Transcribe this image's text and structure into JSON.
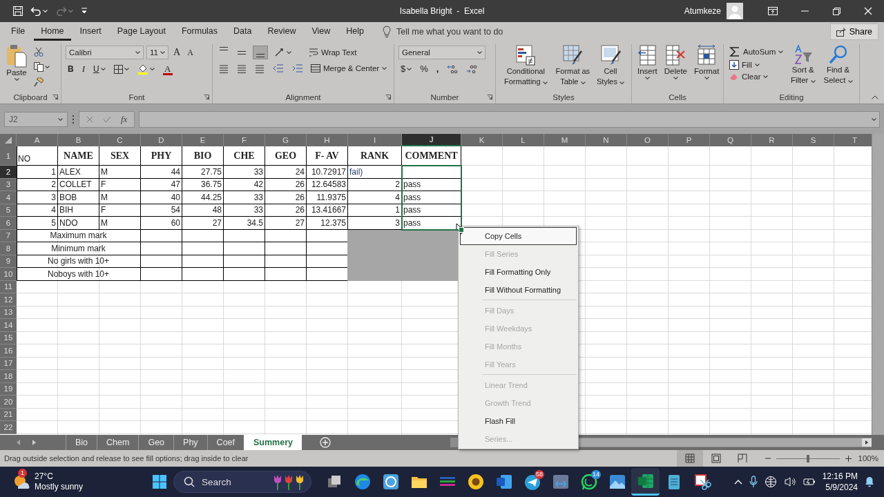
{
  "title_bar": {
    "title": "Isabella Bright  -  Excel",
    "user": "Atumkeze"
  },
  "menu_tabs": [
    {
      "label": "File",
      "selected": false
    },
    {
      "label": "Home",
      "selected": true
    },
    {
      "label": "Insert",
      "selected": false
    },
    {
      "label": "Page Layout",
      "selected": false
    },
    {
      "label": "Formulas",
      "selected": false
    },
    {
      "label": "Data",
      "selected": false
    },
    {
      "label": "Review",
      "selected": false
    },
    {
      "label": "View",
      "selected": false
    },
    {
      "label": "Help",
      "selected": false
    }
  ],
  "tell_me": {
    "placeholder": "Tell me what you want to do"
  },
  "share_button": "Share",
  "ribbon": {
    "clipboard": {
      "paste": "Paste",
      "label": "Clipboard"
    },
    "font": {
      "font_name": "Calibri",
      "font_size": "11",
      "grow": "A",
      "shrink": "A",
      "bold": "B",
      "italic": "I",
      "underline": "U",
      "font_color": "A",
      "label": "Font"
    },
    "alignment": {
      "valign": [
        {
          "selected": false
        },
        {
          "selected": false
        },
        {
          "selected": true
        }
      ],
      "wrap_text": "Wrap Text",
      "merge_center": "Merge & Center",
      "label": "Alignment"
    },
    "number": {
      "format": "General",
      "currency": "$",
      "percent": "%",
      "comma": ",",
      "label": "Number"
    },
    "styles": {
      "buttons": [
        "Conditional Formatting",
        "Format as Table",
        "Cell Styles"
      ],
      "label": "Styles"
    },
    "cells": {
      "buttons": [
        "Insert",
        "Delete",
        "Format"
      ],
      "label": "Cells"
    },
    "editing": {
      "autosum": "AutoSum",
      "fill": "Fill",
      "clear": "Clear",
      "sort_filter": "Sort & Filter",
      "find_select": "Find & Select",
      "label": "Editing"
    }
  },
  "formula_bar": {
    "name_box": "J2",
    "fx": "fx"
  },
  "sheet": {
    "columns": [
      {
        "label": "A",
        "selected": false
      },
      {
        "label": "B",
        "selected": false
      },
      {
        "label": "C",
        "selected": false
      },
      {
        "label": "D",
        "selected": false
      },
      {
        "label": "E",
        "selected": false
      },
      {
        "label": "F",
        "selected": false
      },
      {
        "label": "G",
        "selected": false
      },
      {
        "label": "H",
        "selected": false
      },
      {
        "label": "I",
        "selected": false
      },
      {
        "label": "J",
        "selected": true
      },
      {
        "label": "K",
        "selected": false
      },
      {
        "label": "L",
        "selected": false
      },
      {
        "label": "M",
        "selected": false
      },
      {
        "label": "N",
        "selected": false
      },
      {
        "label": "O",
        "selected": false
      },
      {
        "label": "P",
        "selected": false
      },
      {
        "label": "Q",
        "selected": false
      },
      {
        "label": "R",
        "selected": false
      },
      {
        "label": "S",
        "selected": false
      },
      {
        "label": "T",
        "selected": false
      }
    ],
    "row_headers": [
      {
        "label": "1",
        "selected": false
      },
      {
        "label": "2",
        "selected": true
      },
      {
        "label": "3",
        "selected": false
      },
      {
        "label": "4",
        "selected": false
      },
      {
        "label": "5",
        "selected": false
      },
      {
        "label": "6",
        "selected": false
      },
      {
        "label": "7",
        "selected": false
      },
      {
        "label": "8",
        "selected": false
      },
      {
        "label": "9",
        "selected": false
      },
      {
        "label": "10",
        "selected": false
      },
      {
        "label": "11",
        "selected": false
      },
      {
        "label": "12",
        "selected": false
      },
      {
        "label": "13",
        "selected": false
      },
      {
        "label": "14",
        "selected": false
      },
      {
        "label": "15",
        "selected": false
      },
      {
        "label": "16",
        "selected": false
      },
      {
        "label": "17",
        "selected": false
      },
      {
        "label": "18",
        "selected": false
      },
      {
        "label": "19",
        "selected": false
      },
      {
        "label": "20",
        "selected": false
      },
      {
        "label": "21",
        "selected": false
      },
      {
        "label": "22",
        "selected": false
      }
    ],
    "table": {
      "header": [
        "NO",
        "NAME",
        "SEX",
        "PHY",
        "BIO",
        "CHE",
        "GEO",
        "F- AV",
        "RANK",
        "COMMENT"
      ],
      "rows": [
        {
          "no": "1",
          "name": "ALEX",
          "sex": "M",
          "phy": "44",
          "bio": "27.75",
          "che": "33",
          "geo": "24",
          "f_av": "10.72917",
          "rank_note": "fail)"
        },
        {
          "no": "2",
          "name": "COLLET",
          "sex": "F",
          "phy": "47",
          "bio": "36.75",
          "che": "42",
          "geo": "26",
          "f_av": "12.64583",
          "rank": "2",
          "comment": "pass"
        },
        {
          "no": "3",
          "name": "BOB",
          "sex": "M",
          "phy": "40",
          "bio": "44.25",
          "che": "33",
          "geo": "26",
          "f_av": "11.9375",
          "rank": "4",
          "comment": "pass"
        },
        {
          "no": "4",
          "name": "BIH",
          "sex": "F",
          "phy": "54",
          "bio": "48",
          "che": "33",
          "geo": "26",
          "f_av": "13.41667",
          "rank": "1",
          "comment": "pass"
        },
        {
          "no": "5",
          "name": "NDO",
          "sex": "M",
          "phy": "60",
          "bio": "27",
          "che": "34.5",
          "geo": "27",
          "f_av": "12.375",
          "rank": "3",
          "comment": "pass"
        }
      ],
      "summary_rows": [
        "Maximum mark",
        "Minimum mark",
        "No girls with 10+",
        "Noboys with 10+"
      ]
    },
    "selection_outline": true,
    "fill_preview": true
  },
  "context_menu": {
    "items": [
      {
        "kind": "item",
        "label": "Copy Cells",
        "disabled": false,
        "selected": true
      },
      {
        "kind": "item",
        "label": "Fill Series",
        "disabled": true,
        "selected": false
      },
      {
        "kind": "item",
        "label": "Fill Formatting Only",
        "disabled": false,
        "selected": false
      },
      {
        "kind": "item",
        "label": "Fill Without Formatting",
        "disabled": false,
        "selected": false
      },
      {
        "kind": "separator"
      },
      {
        "kind": "item",
        "label": "Fill Days",
        "disabled": true,
        "selected": false
      },
      {
        "kind": "item",
        "label": "Fill Weekdays",
        "disabled": true,
        "selected": false
      },
      {
        "kind": "item",
        "label": "Fill Months",
        "disabled": true,
        "selected": false
      },
      {
        "kind": "item",
        "label": "Fill Years",
        "disabled": true,
        "selected": false
      },
      {
        "kind": "separator"
      },
      {
        "kind": "item",
        "label": "Linear Trend",
        "disabled": true,
        "selected": false
      },
      {
        "kind": "item",
        "label": "Growth Trend",
        "disabled": true,
        "selected": false
      },
      {
        "kind": "item",
        "label": "Flash Fill",
        "disabled": false,
        "selected": false
      },
      {
        "kind": "item",
        "label": "Series...",
        "disabled": true,
        "selected": false
      }
    ]
  },
  "sheet_tabs": [
    {
      "label": "Bio",
      "selected": false
    },
    {
      "label": "Chem",
      "selected": false
    },
    {
      "label": "Geo",
      "selected": false
    },
    {
      "label": "Phy",
      "selected": false
    },
    {
      "label": "Coef",
      "selected": false
    },
    {
      "label": "Summery",
      "selected": true
    }
  ],
  "status_bar": {
    "message": "Drag outside selection and release to see fill options; drag inside to clear",
    "views": [
      {
        "selected": true
      },
      {
        "selected": false
      },
      {
        "selected": false
      }
    ],
    "zoom_slider": {
      "level": 0.5
    },
    "zoom": "100%"
  },
  "taskbar": {
    "weather_badge": "1",
    "temperature": "27°C",
    "weather": "Mostly sunny",
    "search": {
      "placeholder": "Search"
    },
    "app_badges": [
      "58",
      "14"
    ],
    "time": "12:16 PM",
    "date": "5/9/2024"
  }
}
